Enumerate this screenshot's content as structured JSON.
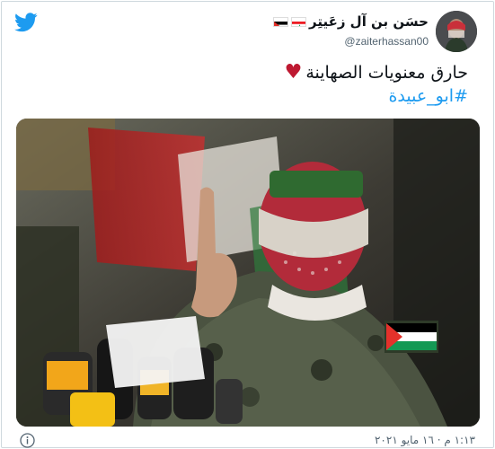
{
  "tweet": {
    "author": {
      "display_name": "حسَن بن آل زعَيتِر",
      "handle": "@zaiterhassan00",
      "flags": [
        "lebanon-flag",
        "palestine-flag"
      ]
    },
    "text": "حارق معنويات الصهاينة",
    "emoji": "heart",
    "hashtag": "#ابو_عبيدة",
    "timestamp": "١:١٣ م · ١٦ مايو ٢٠٢١"
  },
  "icons": {
    "logo": "twitter-bird-icon",
    "info": "info-icon"
  },
  "colors": {
    "twitter_blue": "#1d9bf0",
    "heart_red": "#be1931",
    "text_primary": "#0f1419",
    "text_secondary": "#536471",
    "border": "#cfd9de"
  }
}
